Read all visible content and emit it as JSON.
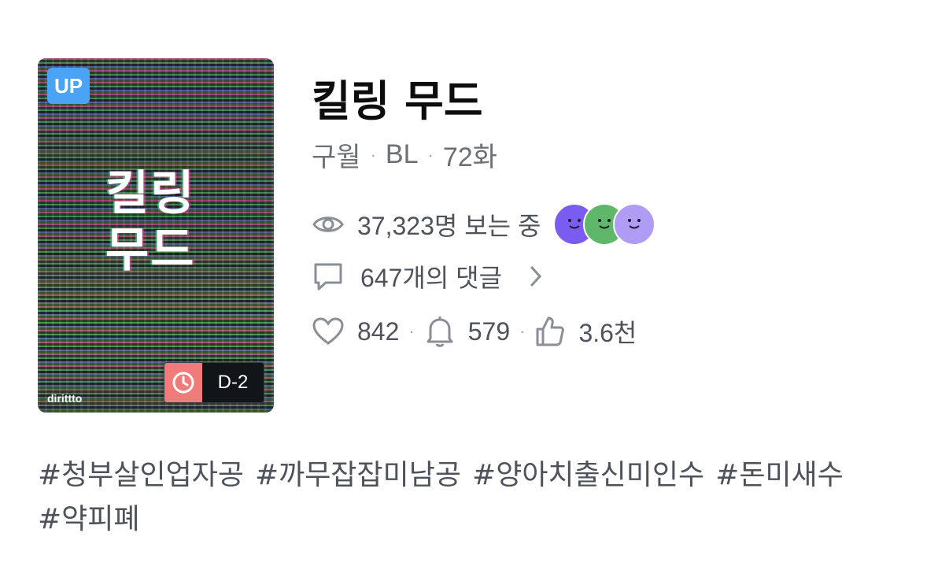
{
  "cover": {
    "badge": "UP",
    "title_line1": "킬링",
    "title_line2": "무드",
    "brand": "dirittto",
    "dday": "D-2",
    "dday_icon": "clock-icon",
    "colors": {
      "badge": "#4aa3f5",
      "dday": "#f07b7b"
    }
  },
  "work": {
    "title": "킬링 무드",
    "author": "구월",
    "genre": "BL",
    "episodes": "72화"
  },
  "viewers": {
    "text": "37,323명 보는 중",
    "icon": "eye-icon",
    "avatars": [
      {
        "color": "#7b5cf0",
        "icon": "smiley-avatar"
      },
      {
        "color": "#5fb86a",
        "icon": "smiley-avatar"
      },
      {
        "color": "#b09bf5",
        "icon": "smiley-avatar"
      }
    ]
  },
  "comments": {
    "text": "647개의 댓글",
    "icon": "comment-icon",
    "chevron": "chevron-right-icon"
  },
  "stats": {
    "likes": "842",
    "subscribers": "579",
    "recommends": "3.6천"
  },
  "tags": [
    "#청부살인업자공",
    "#까무잡잡미남공",
    "#양아치출신미인수",
    "#돈미새수",
    "#약피폐"
  ]
}
